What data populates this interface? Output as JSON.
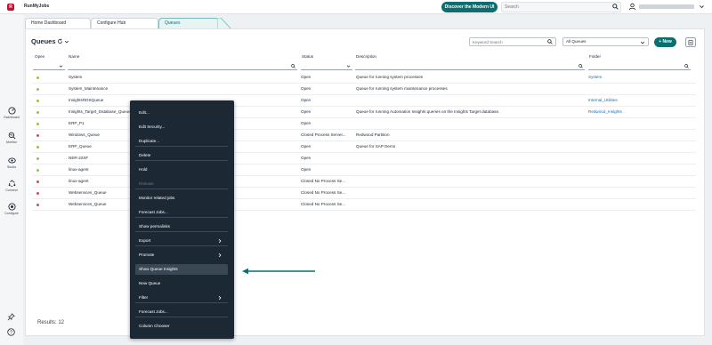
{
  "app": {
    "logo_letter": "R",
    "title": "RunMyJobs"
  },
  "topbar": {
    "discover_label": "Discover the Modern UI",
    "search_placeholder": "Search"
  },
  "sidebar": {
    "items": [
      {
        "label": "Dashboard",
        "icon": "dashboard-icon"
      },
      {
        "label": "Monitor",
        "icon": "monitor-icon"
      },
      {
        "label": "Studio",
        "icon": "studio-icon"
      },
      {
        "label": "Connect",
        "icon": "connect-icon"
      },
      {
        "label": "Configure",
        "icon": "configure-icon"
      }
    ]
  },
  "tabs": [
    {
      "label": "Home Dashboard",
      "active": false
    },
    {
      "label": "Configure Hub",
      "active": false
    },
    {
      "label": "Queues",
      "active": true
    }
  ],
  "panel": {
    "title": "Queues",
    "keyword_placeholder": "Keyword Search",
    "filter_value": "All Queues",
    "new_label": "+ New"
  },
  "columns": {
    "open": "Open",
    "name": "Name",
    "status": "Status",
    "description": "Description",
    "folder": "Folder"
  },
  "rows": [
    {
      "status_color": "#9bc53d",
      "name": "System",
      "status": "Open",
      "description": "Queue for running system processes",
      "folder": "System"
    },
    {
      "status_color": "#9bc53d",
      "name": "System_Maintenance",
      "status": "Open",
      "description": "Queue for running system maintenance processes",
      "folder": ""
    },
    {
      "status_color": "#9bc53d",
      "name": "InsightsRDSQueue",
      "status": "Open",
      "description": "",
      "folder": "Internal_Utilities"
    },
    {
      "status_color": "#9bc53d",
      "name": "Insights_Target_Database_Queue",
      "status": "Open",
      "description": "Queue for running Automation Insights queries on the Insights Target database.",
      "folder": "Redwood_Insights"
    },
    {
      "status_color": "#9bc53d",
      "name": "ERP_P1",
      "status": "Open",
      "description": "",
      "folder": ""
    },
    {
      "status_color": "#e0474c",
      "name": "Windows_Queue",
      "status": "Closed Process Server...",
      "description": "Redwood Partition",
      "folder": ""
    },
    {
      "status_color": "#9bc53d",
      "name": "ERP_Queue",
      "status": "Open",
      "description": "Queue for SAP Demo",
      "folder": ""
    },
    {
      "status_color": "#9bc53d",
      "name": "NER-22SF",
      "status": "Open",
      "description": "",
      "folder": ""
    },
    {
      "status_color": "#9bc53d",
      "name": "linux-agent",
      "status": "Open",
      "description": "",
      "folder": ""
    },
    {
      "status_color": "#e0474c",
      "name": "linux-agent",
      "status": "Closed No Process Se...",
      "description": "",
      "folder": ""
    },
    {
      "status_color": "#e0474c",
      "name": "Webservices_Queue",
      "status": "Closed No Process Se...",
      "description": "",
      "folder": ""
    },
    {
      "status_color": "#e0474c",
      "name": "Webservices_Queue",
      "status": "Closed No Process Se...",
      "description": "",
      "folder": ""
    }
  ],
  "results_label": "Results: 12",
  "context_menu": {
    "items": [
      {
        "label": "Edit...",
        "disabled": false,
        "submenu": false
      },
      {
        "label": "Edit Security...",
        "disabled": false,
        "submenu": false
      },
      {
        "label": "Duplicate...",
        "disabled": false,
        "submenu": false
      },
      {
        "label": "Delete",
        "disabled": false,
        "submenu": false
      },
      {
        "label": "Hold",
        "disabled": false,
        "submenu": false
      },
      {
        "label": "Release",
        "disabled": true,
        "submenu": false
      },
      {
        "label": "Monitor related jobs",
        "disabled": false,
        "submenu": false
      },
      {
        "label": "Forecast Jobs...",
        "disabled": false,
        "submenu": false
      },
      {
        "label": "Show permalinks",
        "disabled": false,
        "submenu": false
      },
      {
        "label": "Export",
        "disabled": false,
        "submenu": true
      },
      {
        "label": "Promote",
        "disabled": false,
        "submenu": true
      },
      {
        "label": "Show Queue Insights",
        "disabled": false,
        "submenu": false,
        "highlighted": true
      },
      {
        "label": "New Queue",
        "disabled": false,
        "submenu": false
      },
      {
        "label": "Filter",
        "disabled": false,
        "submenu": true
      },
      {
        "label": "Forecast Jobs...",
        "disabled": false,
        "submenu": false
      },
      {
        "label": "Column Chooser",
        "disabled": false,
        "submenu": false
      }
    ]
  },
  "colors": {
    "accent": "#0b6f71",
    "open_dot": "#9bc53d",
    "closed_dot": "#e0474c",
    "menu_bg": "#1c2833",
    "link": "#1a6fb5"
  }
}
